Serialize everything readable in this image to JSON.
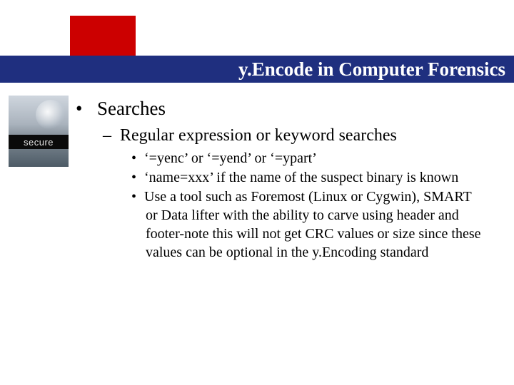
{
  "header": {
    "title": "y.Encode in Computer Forensics"
  },
  "sidebar_image": {
    "label": "secure"
  },
  "content": {
    "l1": "Searches",
    "l2": "Regular expression or keyword searches",
    "l3a": "‘=yenc’ or ‘=yend’ or ‘=ypart’",
    "l3b": "‘name=xxx’ if the name of the suspect binary is known",
    "l3c": "Use a tool such as Foremost (Linux or Cygwin), SMART or Data lifter with the ability to carve using header and footer-note this will not get CRC values or size since these values can be optional in the y.Encoding standard"
  }
}
